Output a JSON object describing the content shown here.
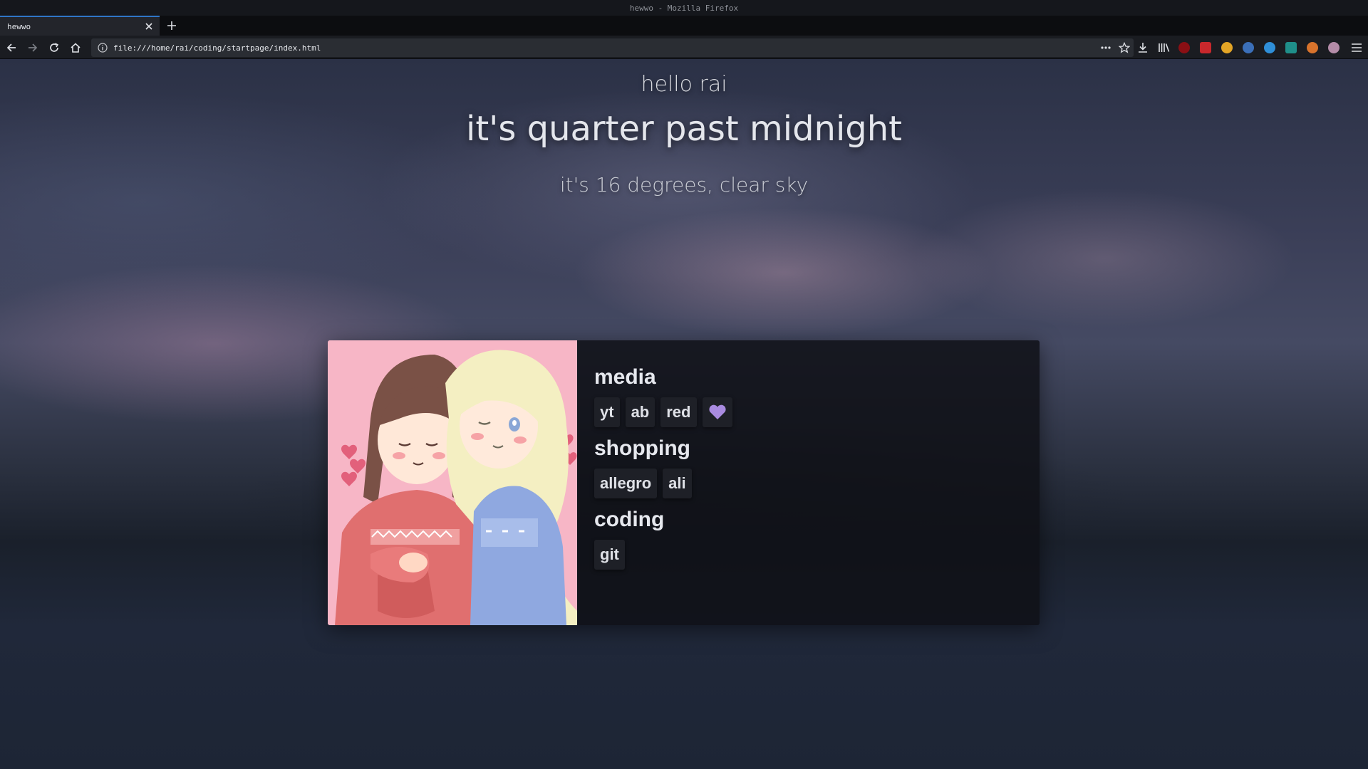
{
  "window": {
    "title": "hewwo - Mozilla Firefox"
  },
  "tabs": [
    {
      "title": "hewwo",
      "active": true
    }
  ],
  "navbar": {
    "url": "file:///home/rai/coding/startpage/index.html"
  },
  "toolbar_icons": [
    "download-icon",
    "library-icon",
    "ublock-icon",
    "extension-red-icon",
    "extension-yellow-icon",
    "extension-dots-icon",
    "stylus-icon",
    "extension-teal-icon",
    "extension-orange-icon",
    "avatar-icon",
    "hamburger-menu-icon"
  ],
  "page": {
    "greeting": "hello rai",
    "time": "it's quarter past midnight",
    "weather": "it's 16 degrees, clear sky"
  },
  "categories": [
    {
      "title": "media",
      "links": [
        "yt",
        "ab",
        "red"
      ],
      "extra_icon": "heart-icon"
    },
    {
      "title": "shopping",
      "links": [
        "allegro",
        "ali"
      ]
    },
    {
      "title": "coding",
      "links": [
        "git"
      ]
    }
  ],
  "colors": {
    "accent_tab": "#2f76c6",
    "heart": "#a98be0",
    "card_art_bg": "#f7b6c6"
  }
}
